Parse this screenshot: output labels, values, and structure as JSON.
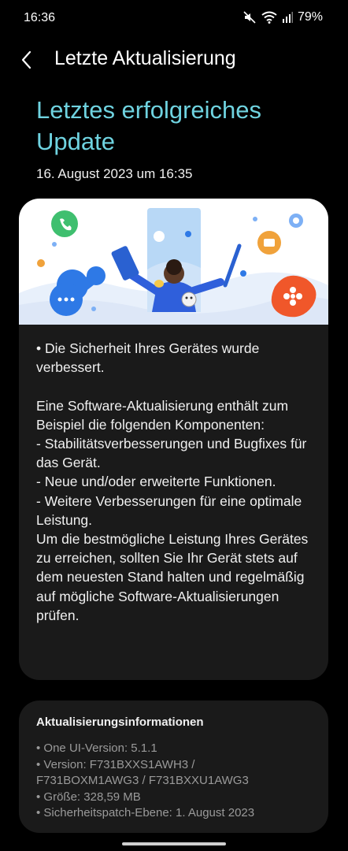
{
  "status_bar": {
    "time": "16:36",
    "battery": "79%",
    "icons": [
      "mute-icon",
      "wifi-icon",
      "signal-icon"
    ]
  },
  "app_bar": {
    "back_icon": "chevron-left-icon",
    "title": "Letzte Aktualisierung"
  },
  "hero": {
    "title": "Letztes erfolgreiches Update",
    "date": "16. August 2023 um 16:35",
    "accent_color": "#6fd3e0"
  },
  "release_notes": {
    "text": "• Die Sicherheit Ihres Gerätes wurde verbessert.\n\nEine Software-Aktualisierung enthält zum Beispiel die folgenden Komponenten:\n - Stabilitätsverbesserungen und Bugfixes für das Gerät.\n - Neue und/oder erweiterte Funktionen.\n - Weitere Verbesserungen für eine optimale Leistung.\nUm die bestmögliche Leistung Ihres Gerätes zu erreichen, sollten Sie Ihr Gerät stets auf dem neuesten Stand halten und regelmäßig auf mögliche Software-Aktualisierungen prüfen."
  },
  "update_info": {
    "title": "Aktualisierungsinformationen",
    "items": [
      "• One UI-Version: 5.1.1",
      "• Version: F731BXXS1AWH3 /\n   F731BOXM1AWG3 / F731BXXU1AWG3",
      "• Größe: 328,59 MB",
      "• Sicherheitspatch-Ebene: 1. August 2023"
    ]
  }
}
